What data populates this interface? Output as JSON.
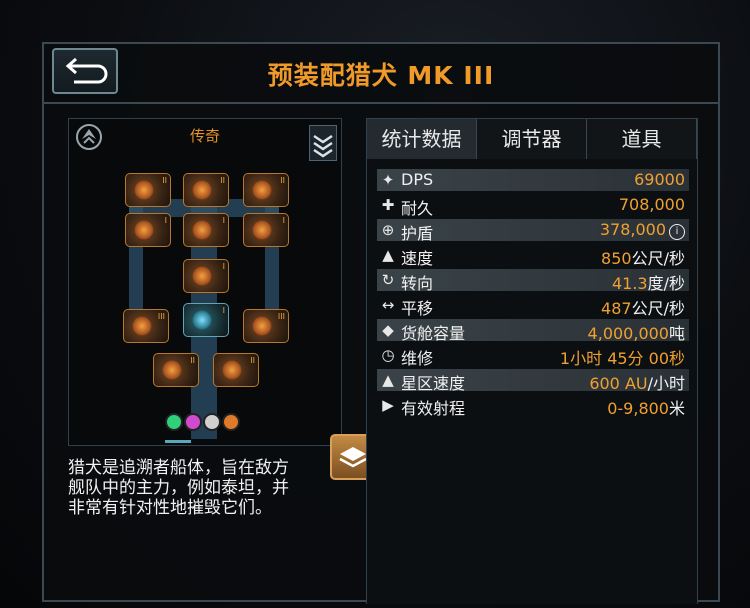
{
  "header": {
    "title": "预装配猎犬 MK III"
  },
  "ship": {
    "rarity": "传奇",
    "description_lines": [
      "猎犬是追溯者船体，旨在敌方",
      "舰队中的主力，例如泰坦，并",
      "非常有针对性地摧毁它们。"
    ],
    "color_dots": [
      "#2fd07a",
      "#d04ad0",
      "#d0d0d0",
      "#e07a2a"
    ]
  },
  "tabs": [
    "统计数据",
    "调节器",
    "道具"
  ],
  "stats": [
    {
      "icon": "dps-icon",
      "glyph": "✦",
      "label": "DPS",
      "value": "69000",
      "unit": "",
      "shaded": true
    },
    {
      "icon": "armor-icon",
      "glyph": "✚",
      "label": "耐久",
      "value": "708,000",
      "unit": "",
      "shaded": false
    },
    {
      "icon": "shield-icon",
      "glyph": "⊕",
      "label": "护盾",
      "value": "378,000",
      "unit": "",
      "shaded": true,
      "info": "i"
    },
    {
      "icon": "speed-icon",
      "glyph": "▲",
      "label": "速度",
      "value": "850",
      "unit": "公尺/秒",
      "shaded": false
    },
    {
      "icon": "turn-icon",
      "glyph": "↻",
      "label": "转向",
      "value": "41.3",
      "unit": "度/秒",
      "shaded": true
    },
    {
      "icon": "strafe-icon",
      "glyph": "↔",
      "label": "平移",
      "value": "487",
      "unit": "公尺/秒",
      "shaded": false
    },
    {
      "icon": "cargo-icon",
      "glyph": "◆",
      "label": "货舱容量",
      "value": "4,000,000",
      "unit": "吨",
      "shaded": true
    },
    {
      "icon": "repair-icon",
      "glyph": "◷",
      "label": "维修",
      "value": "1小时 45分 00秒",
      "unit": "",
      "shaded": false
    },
    {
      "icon": "warp-icon",
      "glyph": "▲",
      "label": "星区速度",
      "value": "600 AU",
      "unit": "/小时",
      "shaded": true
    },
    {
      "icon": "range-icon",
      "glyph": "▶",
      "label": "有效射程",
      "value": "0-9,800",
      "unit": "米",
      "shaded": false
    }
  ]
}
